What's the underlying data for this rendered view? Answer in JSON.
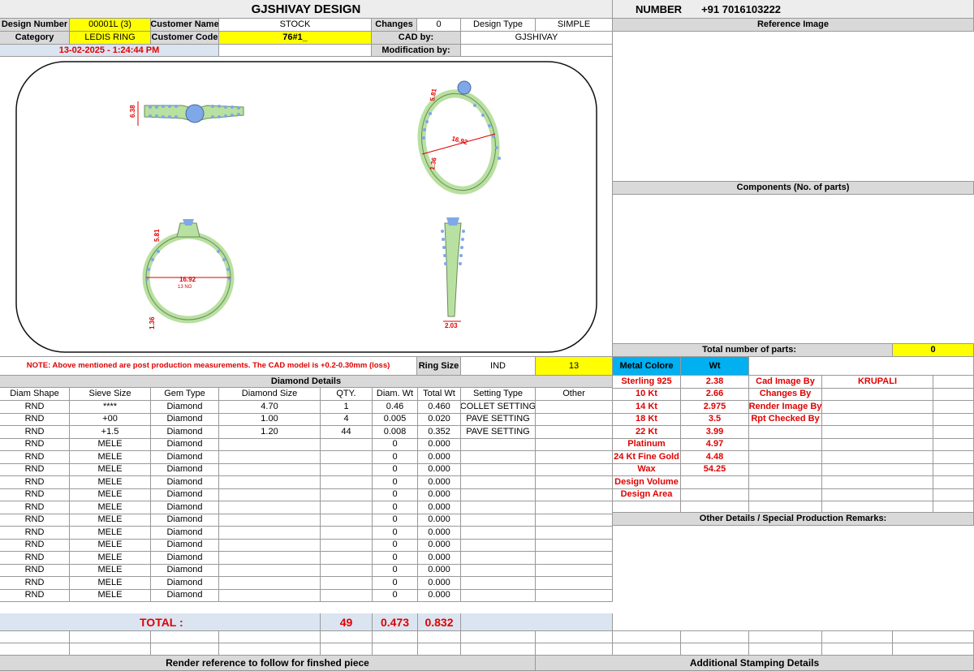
{
  "header": {
    "title": "GJSHIVAY DESIGN",
    "number_label": "NUMBER",
    "number_value": "+91 7016103222"
  },
  "info": {
    "design_number_label": "Design Number",
    "design_number": "00001L (3)",
    "customer_name_label": "Customer Name",
    "customer_name": "STOCK",
    "changes_label": "Changes",
    "changes": "0",
    "design_type_label": "Design Type",
    "design_type": "SIMPLE",
    "category_label": "Category",
    "category": "LEDIS RING",
    "customer_code_label": "Customer Code",
    "customer_code": "76#1_",
    "cad_by_label": "CAD by:",
    "cad_by": "GJSHIVAY",
    "datetime": "13-02-2025 - 1:24:44 PM",
    "modification_label": "Modification by:"
  },
  "right": {
    "reference_image": "Reference Image",
    "components": "Components (No. of parts)",
    "total_parts_label": "Total number of parts:",
    "total_parts": "0"
  },
  "render": {
    "dims": {
      "top_height": "6.38",
      "top_face": "5.81",
      "side_width": "16.92",
      "shank": "1.36",
      "front_face": "5.81",
      "front_width": "16.92",
      "size": "13 NO",
      "front_shank": "1.36",
      "side_bottom": "2.03"
    }
  },
  "note": "NOTE: Above mentioned are post production measurements. The CAD model is +0.2-0.30mm (loss)",
  "ring_size": {
    "label": "Ring Size",
    "unit": "IND",
    "value": "13"
  },
  "metal": {
    "label": "Metal Colore",
    "wt_label": "Wt",
    "rows": [
      {
        "name": "Sterling 925",
        "wt": "2.38",
        "extra_label": "Cad Image By",
        "extra_value": "KRUPALI"
      },
      {
        "name": "10 Kt",
        "wt": "2.66",
        "extra_label": "Changes By",
        "extra_value": ""
      },
      {
        "name": "14 Kt",
        "wt": "2.975",
        "extra_label": "Render Image By",
        "extra_value": ""
      },
      {
        "name": "18 Kt",
        "wt": "3.5",
        "extra_label": "Rpt Checked By",
        "extra_value": ""
      },
      {
        "name": "22 Kt",
        "wt": "3.99",
        "extra_label": "",
        "extra_value": ""
      },
      {
        "name": "Platinum",
        "wt": "4.97",
        "extra_label": "",
        "extra_value": ""
      },
      {
        "name": "24 Kt Fine Gold",
        "wt": "4.48",
        "extra_label": "",
        "extra_value": ""
      },
      {
        "name": "Wax",
        "wt": "54.25",
        "extra_label": "",
        "extra_value": ""
      },
      {
        "name": "Design Volume",
        "wt": "",
        "extra_label": "",
        "extra_value": ""
      },
      {
        "name": "Design Area",
        "wt": "",
        "extra_label": "",
        "extra_value": ""
      }
    ]
  },
  "other_details": "Other Details / Special Production Remarks:",
  "diamonds": {
    "title": "Diamond Details",
    "headers": [
      "Diam Shape",
      "Sieve Size",
      "Gem Type",
      "Diamond Size",
      "QTY.",
      "Diam. Wt",
      "Total Wt",
      "Setting Type",
      "Other"
    ],
    "rows": [
      [
        "RND",
        "****",
        "Diamond",
        "4.70",
        "1",
        "0.46",
        "0.460",
        "COLLET SETTING",
        ""
      ],
      [
        "RND",
        "+00",
        "Diamond",
        "1.00",
        "4",
        "0.005",
        "0.020",
        "PAVE SETTING",
        ""
      ],
      [
        "RND",
        "+1.5",
        "Diamond",
        "1.20",
        "44",
        "0.008",
        "0.352",
        "PAVE SETTING",
        ""
      ],
      [
        "RND",
        "MELE",
        "Diamond",
        "",
        "",
        "0",
        "0.000",
        "",
        ""
      ],
      [
        "RND",
        "MELE",
        "Diamond",
        "",
        "",
        "0",
        "0.000",
        "",
        ""
      ],
      [
        "RND",
        "MELE",
        "Diamond",
        "",
        "",
        "0",
        "0.000",
        "",
        ""
      ],
      [
        "RND",
        "MELE",
        "Diamond",
        "",
        "",
        "0",
        "0.000",
        "",
        ""
      ],
      [
        "RND",
        "MELE",
        "Diamond",
        "",
        "",
        "0",
        "0.000",
        "",
        ""
      ],
      [
        "RND",
        "MELE",
        "Diamond",
        "",
        "",
        "0",
        "0.000",
        "",
        ""
      ],
      [
        "RND",
        "MELE",
        "Diamond",
        "",
        "",
        "0",
        "0.000",
        "",
        ""
      ],
      [
        "RND",
        "MELE",
        "Diamond",
        "",
        "",
        "0",
        "0.000",
        "",
        ""
      ],
      [
        "RND",
        "MELE",
        "Diamond",
        "",
        "",
        "0",
        "0.000",
        "",
        ""
      ],
      [
        "RND",
        "MELE",
        "Diamond",
        "",
        "",
        "0",
        "0.000",
        "",
        ""
      ],
      [
        "RND",
        "MELE",
        "Diamond",
        "",
        "",
        "0",
        "0.000",
        "",
        ""
      ],
      [
        "RND",
        "MELE",
        "Diamond",
        "",
        "",
        "0",
        "0.000",
        "",
        ""
      ],
      [
        "RND",
        "MELE",
        "Diamond",
        "",
        "",
        "0",
        "0.000",
        "",
        ""
      ]
    ],
    "total_label": "TOTAL :",
    "total_qty": "49",
    "total_diam_wt": "0.473",
    "total_wt": "0.832"
  },
  "footer": {
    "left": "Render reference to follow for finshed piece",
    "right": "Additional Stamping Details"
  },
  "colors": {
    "yellow": "#ffff00",
    "cyan": "#00b0f0",
    "red": "#e00000",
    "metal": "#b8e0a0",
    "stone": "#7fa8e8"
  }
}
